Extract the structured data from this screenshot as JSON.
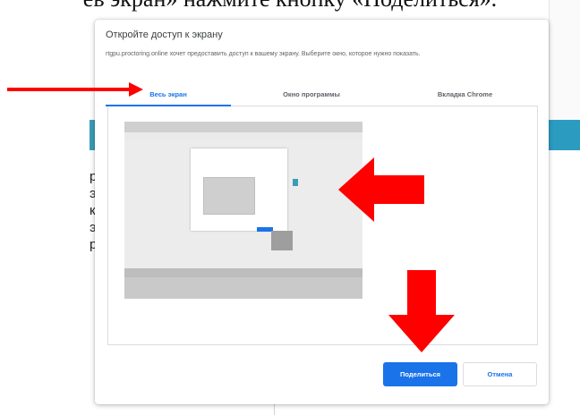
{
  "caption": {
    "text": "ев экран» нажмите кнопку «Поделиться»."
  },
  "background": {
    "letters": [
      "р",
      "э",
      "к",
      "э",
      "р"
    ]
  },
  "dialog": {
    "title": "Откройте доступ к экрану",
    "description": "rtgpu.proctoring.online хочет предоставить доступ к вашему экрану. Выберите окно, которое нужно показать.",
    "tabs": [
      {
        "label": "Весь экран",
        "selected": true
      },
      {
        "label": "Окно программы",
        "selected": false
      },
      {
        "label": "Вкладка Chrome",
        "selected": false
      }
    ],
    "buttons": {
      "share_label": "Поделиться",
      "cancel_label": "Отмена"
    }
  },
  "colors": {
    "accent": "#1a73e8",
    "annotation": "#ff0000",
    "teal": "#2b9bc0"
  }
}
